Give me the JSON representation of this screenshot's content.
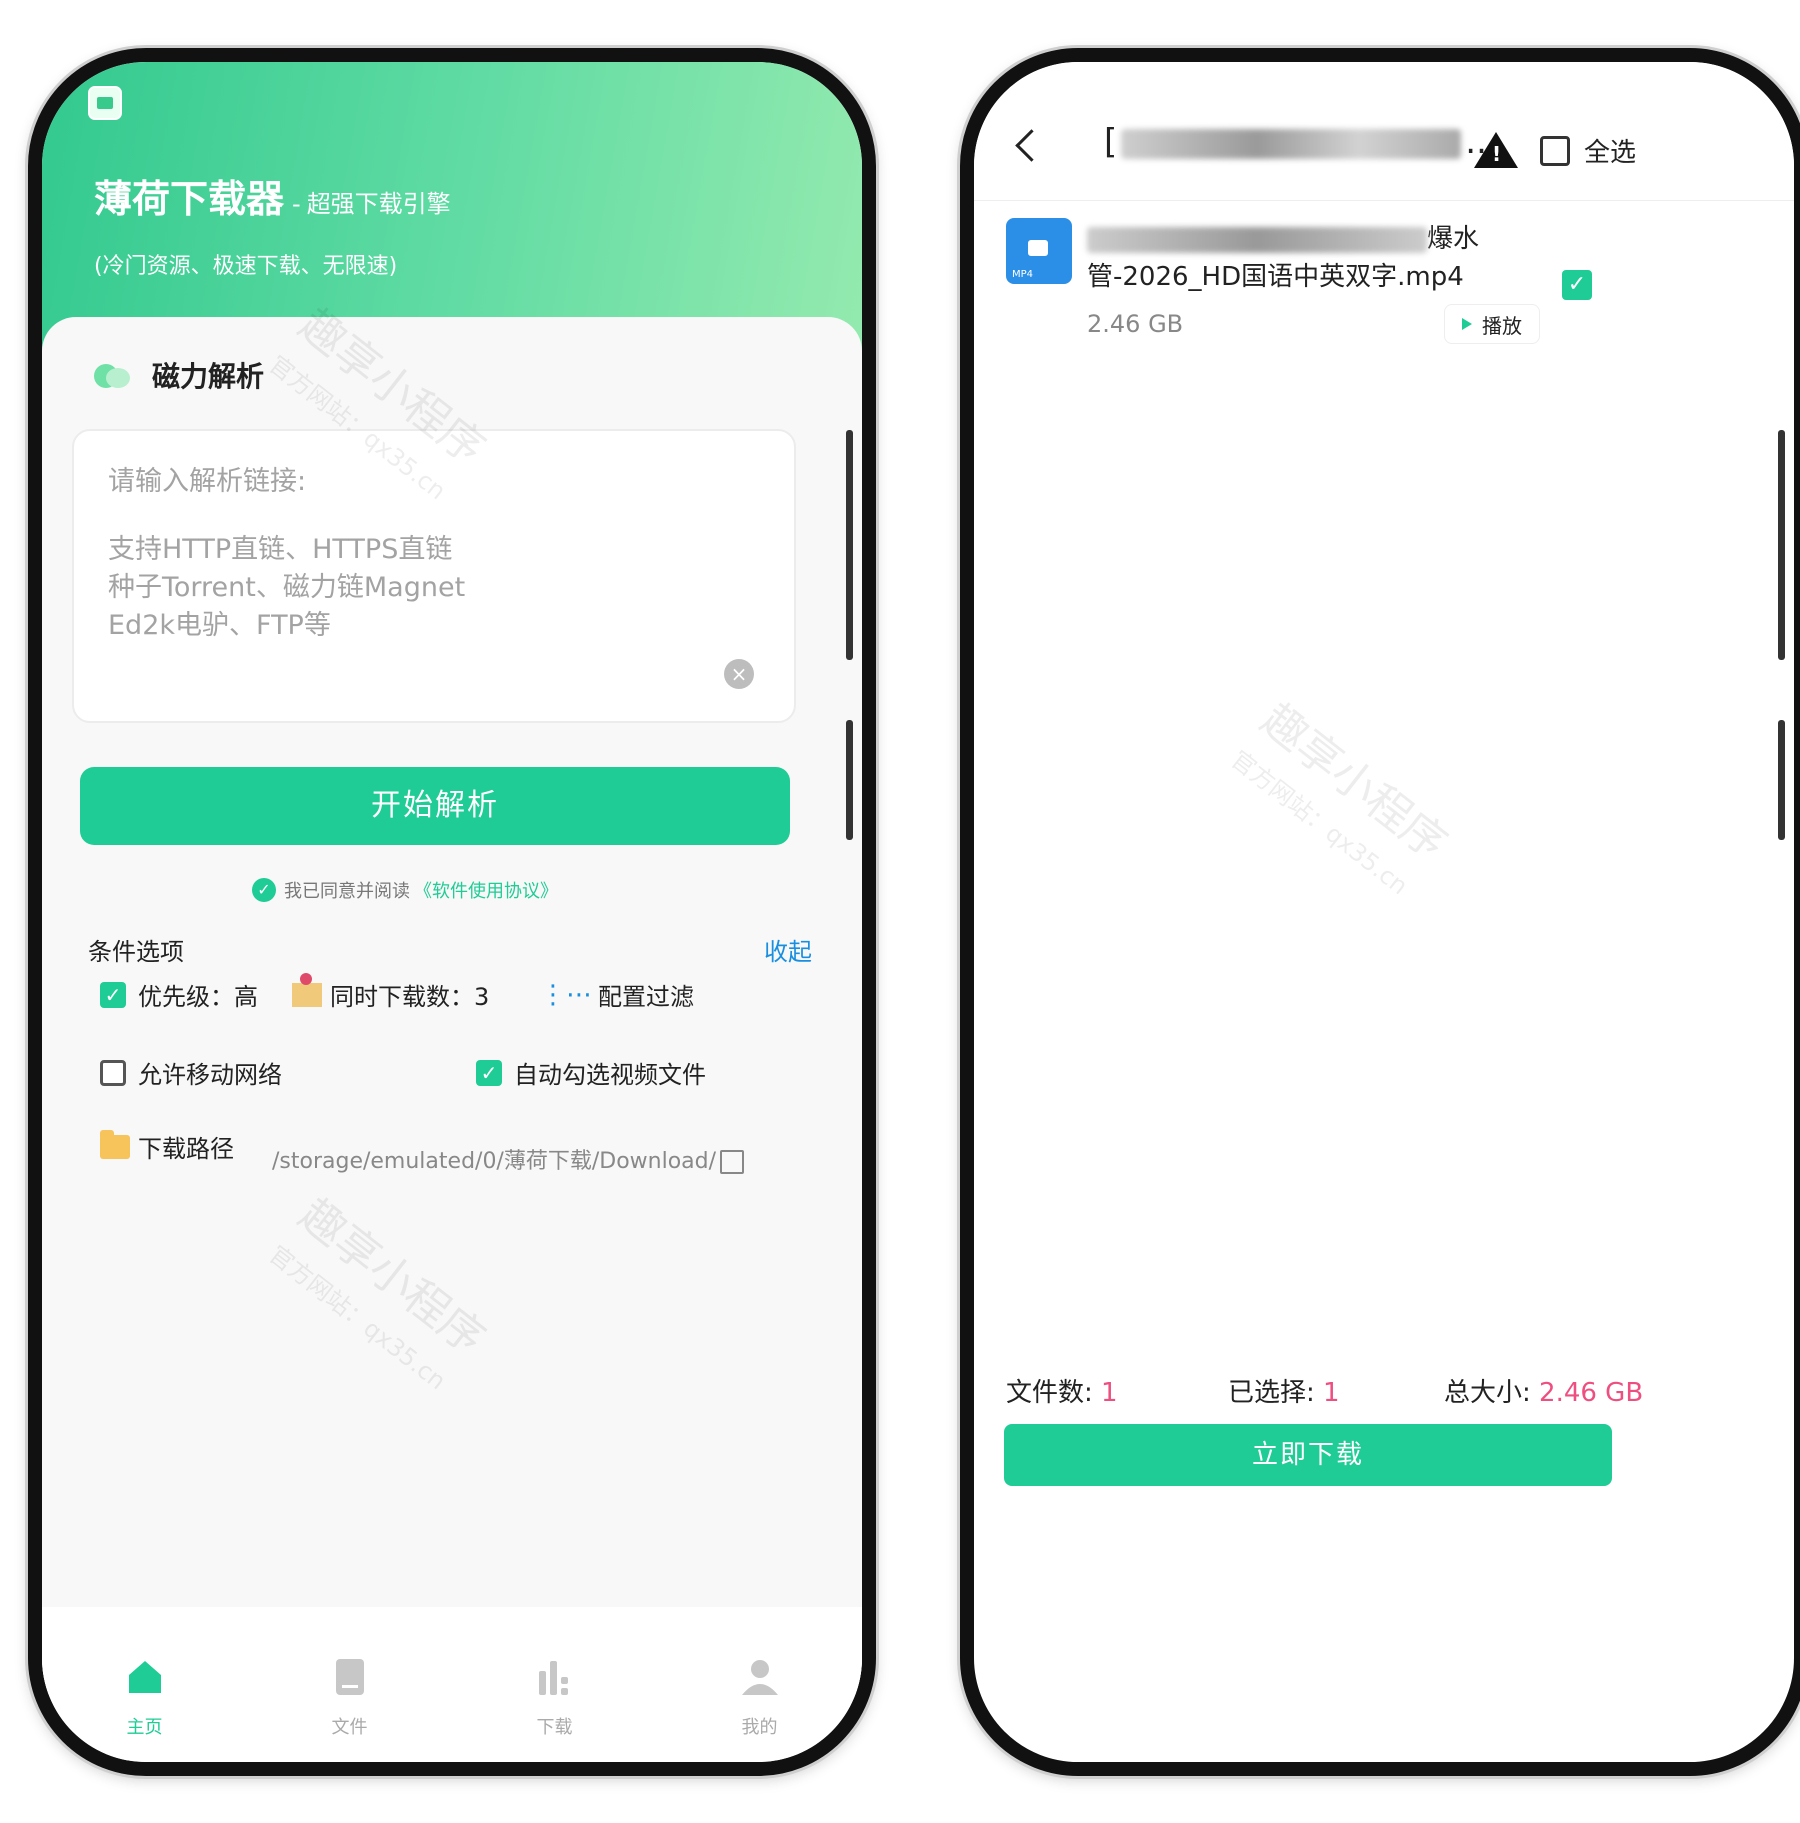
{
  "left_phone": {
    "header": {
      "app_name": "薄荷下载器",
      "dash": "-",
      "tagline": "超强下载引擎",
      "subtitle": "(冷门资源、极速下载、无限速)"
    },
    "section": {
      "title": "磁力解析"
    },
    "input": {
      "placeholder_title": "请输入解析链接:",
      "placeholder_lines": [
        "支持HTTP直链、HTTPS直链",
        "种子Torrent、磁力链Magnet",
        "Ed2k电驴、FTP等"
      ]
    },
    "start_button": "开始解析",
    "agreement": {
      "text": "我已同意并阅读",
      "link": "《软件使用协议》"
    },
    "options": {
      "label": "条件选项",
      "collapse": "收起",
      "priority": "优先级：高",
      "concurrent": "同时下载数：3",
      "filter": "配置过滤",
      "allow_mobile": "允许移动网络",
      "auto_select": "自动勾选视频文件",
      "path_label": "下载路径",
      "path_value": "/storage/emulated/0/薄荷下载/Download/"
    },
    "watermark": {
      "line1": "趣享小程序",
      "line2": "官方网站：qx35.cn"
    },
    "tabs": [
      {
        "label": "主页",
        "icon": "home-icon"
      },
      {
        "label": "文件",
        "icon": "book-icon"
      },
      {
        "label": "下载",
        "icon": "bar-chart-icon"
      },
      {
        "label": "我的",
        "icon": "user-icon"
      }
    ]
  },
  "right_phone": {
    "header": {
      "title_prefix": "[",
      "title_suffix": "...",
      "select_all": "全选"
    },
    "file": {
      "name_tail_1": "爆水",
      "name_line_2": "管-2026_HD国语中英双字.mp4",
      "size": "2.46 GB",
      "play_label": "播放",
      "icon_tag": "MP4"
    },
    "stats": {
      "count_label": "文件数:",
      "count_value": "1",
      "selected_label": "已选择:",
      "selected_value": "1",
      "total_label": "总大小:",
      "total_value": "2.46 GB"
    },
    "download_button": "立即下载"
  },
  "colors": {
    "accent": "#20cc95",
    "link": "#1a8fe0",
    "highlight": "#ee4f80"
  }
}
